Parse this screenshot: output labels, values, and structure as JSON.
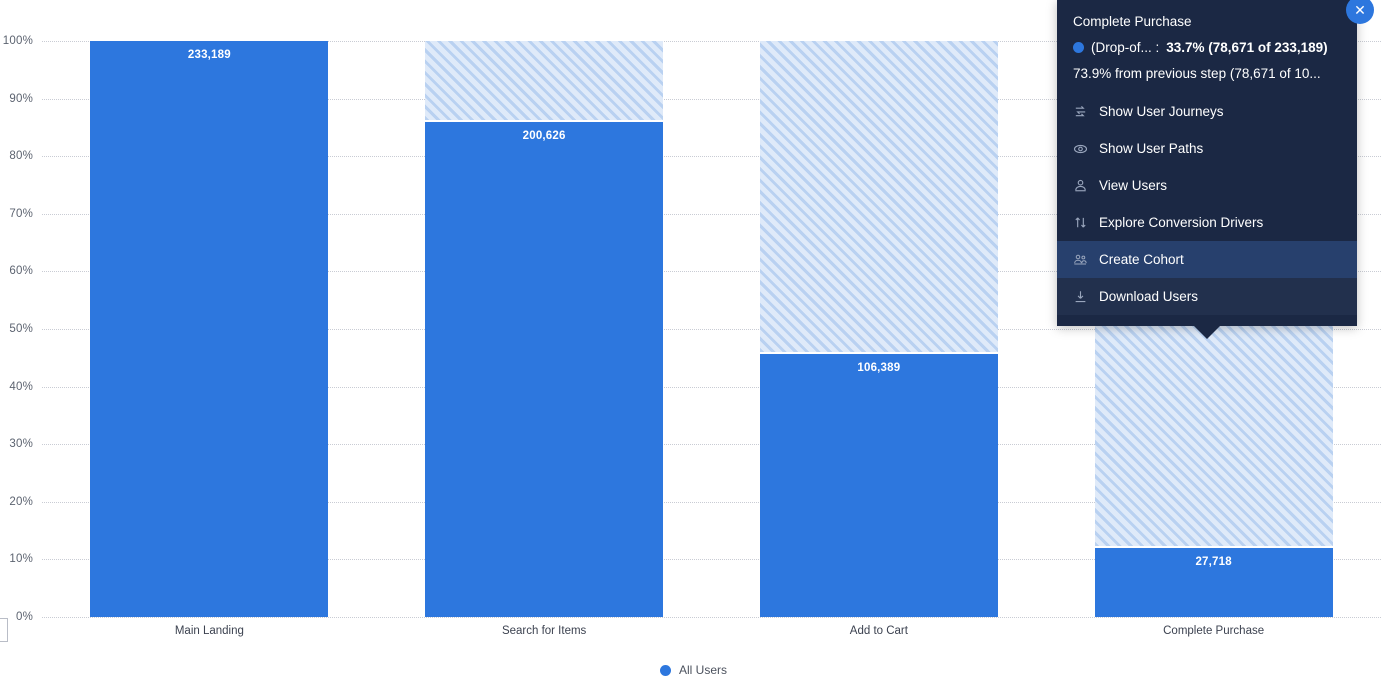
{
  "chart_data": {
    "type": "bar",
    "title": "",
    "xlabel": "",
    "ylabel": "",
    "ylim": [
      0,
      100
    ],
    "grid": true,
    "legend_position": "bottom",
    "categories": [
      "Main Landing",
      "Search for Items",
      "Add to Cart",
      "Complete Purchase"
    ],
    "series": [
      {
        "name": "All Users",
        "values": [
          233189,
          200626,
          106389,
          27718
        ],
        "percent_of_first": [
          100.0,
          86.0,
          45.6,
          11.9
        ],
        "value_labels": [
          "233,189",
          "200,626",
          "106,389",
          "27,718"
        ]
      }
    ],
    "dropoff_percent": [
      0.0,
      14.0,
      54.4,
      88.1
    ],
    "y_ticks": [
      "100%",
      "90%",
      "80%",
      "70%",
      "60%",
      "50%",
      "40%",
      "30%",
      "20%",
      "10%",
      "0%"
    ],
    "y_tick_values": [
      100,
      90,
      80,
      70,
      60,
      50,
      40,
      30,
      20,
      10,
      0
    ],
    "colors": {
      "bar": "#2d77de",
      "dropoff_fill": "#dce8f8",
      "dropoff_hatch": "#b9d1f1",
      "gridline": "#c9ccd4",
      "tooltip_bg": "#1b2844",
      "tooltip_highlight": "#27406d",
      "accent": "#2d77de"
    }
  },
  "legend": {
    "items": [
      {
        "label": "All Users",
        "color": "#2d77de"
      }
    ]
  },
  "tooltip": {
    "title": "Complete Purchase",
    "metric_label": "(Drop-of... :",
    "metric_value": "33.7% (78,671 of 233,189)",
    "previous_step": "73.9% from previous step (78,671 of 10...",
    "close_label": "✕",
    "menu": [
      {
        "label": "Show User Journeys",
        "icon": "user-journeys-icon",
        "highlighted": false
      },
      {
        "label": "Show User Paths",
        "icon": "eye-icon",
        "highlighted": false
      },
      {
        "label": "View Users",
        "icon": "person-icon",
        "highlighted": false
      },
      {
        "label": "Explore Conversion Drivers",
        "icon": "sort-arrows-icon",
        "highlighted": false
      },
      {
        "label": "Create Cohort",
        "icon": "people-group-icon",
        "highlighted": true
      },
      {
        "label": "Download Users",
        "icon": "download-icon",
        "highlighted": false
      }
    ]
  }
}
